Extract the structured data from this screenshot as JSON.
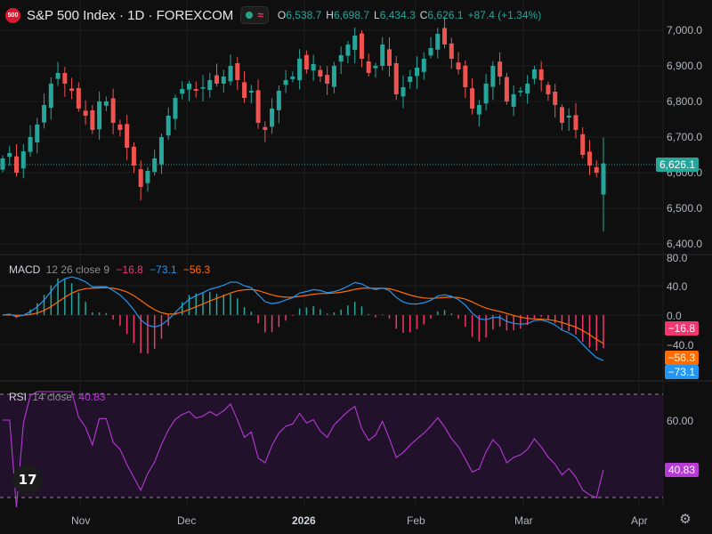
{
  "header": {
    "logo_text": "500",
    "symbol_title": "S&P 500 Index · 1D · FOREXCOM",
    "ohlc": {
      "o_label": "O",
      "o": "6,538.7",
      "h_label": "H",
      "h": "6,698.7",
      "l_label": "L",
      "l": "6,434.3",
      "c_label": "C",
      "c": "6,626.1",
      "change": "+87.4 (+1.34%)"
    },
    "wave_icon": "≈"
  },
  "price_axis": [
    "7,000.0",
    "6,900.0",
    "6,800.0",
    "6,700.0",
    "6,600.0",
    "6,500.0",
    "6,400.0"
  ],
  "last_price_tag": "6,626.1",
  "macd": {
    "label": "MACD",
    "params": "12 26 close 9",
    "hist": "−16.8",
    "macd": "−73.1",
    "signal": "−56.3",
    "axis": [
      "80.0",
      "40.0",
      "0.0",
      "−40.0"
    ],
    "tag_hist": "−16.8",
    "tag_signal": "−56.3",
    "tag_macd": "−73.1"
  },
  "rsi": {
    "label": "RSI",
    "params": "14 close",
    "value": "40.83",
    "axis": [
      "60.00"
    ],
    "tag": "40.83"
  },
  "time_axis": [
    "Nov",
    "Dec",
    "2026",
    "Feb",
    "Mar",
    "Apr"
  ],
  "colors": {
    "up": "#26a69a",
    "down": "#ef5350",
    "macd_line": "#2196f3",
    "signal_line": "#ff6d00",
    "rsi_line": "#b63ad3",
    "hist_neg": "#f23770"
  },
  "chart_data": {
    "type": "candlestick",
    "timeframe": "1D",
    "ylim": [
      6400,
      7000
    ],
    "latest_ohlc": {
      "o": 6538.7,
      "h": 6698.7,
      "l": 6434.3,
      "c": 6626.1
    },
    "approx_closes": [
      6640,
      6655,
      6600,
      6660,
      6700,
      6735,
      6790,
      6850,
      6880,
      6850,
      6830,
      6780,
      6760,
      6720,
      6800,
      6800,
      6740,
      6720,
      6670,
      6620,
      6560,
      6605,
      6640,
      6700,
      6760,
      6810,
      6835,
      6850,
      6830,
      6840,
      6860,
      6850,
      6870,
      6900,
      6860,
      6810,
      6830,
      6740,
      6720,
      6780,
      6830,
      6860,
      6870,
      6920,
      6890,
      6905,
      6870,
      6850,
      6900,
      6930,
      6960,
      6985,
      6920,
      6880,
      6900,
      6960,
      6900,
      6820,
      6840,
      6870,
      6895,
      6920,
      6950,
      6990,
      6960,
      6920,
      6890,
      6840,
      6780,
      6790,
      6850,
      6900,
      6870,
      6800,
      6820,
      6830,
      6850,
      6890,
      6860,
      6820,
      6790,
      6740,
      6760,
      6720,
      6650,
      6620,
      6600,
      6626
    ]
  }
}
